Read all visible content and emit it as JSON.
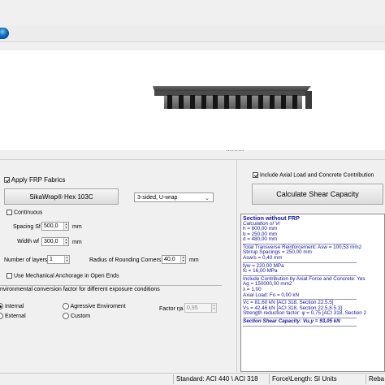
{
  "frp": {
    "apply_label": "Apply FRP Fabrics",
    "product_button": "SikaWrap® Hex 103C",
    "wrap_select": "3-sided, U-wrap",
    "continuous_label": "Continuous",
    "spacing_label": "Spacing Sf",
    "spacing_value": "500,0",
    "spacing_unit": "mm",
    "width_label": "Width wf",
    "width_value": "300,0",
    "width_unit": "mm",
    "layers_label": "Number of layers",
    "layers_value": "1",
    "radius_label": "Radius of Rounding Corners R",
    "radius_value": "40,0",
    "radius_unit": "mm",
    "anchorage_label": "Use Mechanical Anchorage in Open Ends"
  },
  "env": {
    "header": "nvironmental conversion factor for different exposure conditions",
    "options": [
      "Internal",
      "Agressive Enviroment",
      "External",
      "Custom"
    ],
    "factor_label": "Factor ηa",
    "factor_value": "0,95"
  },
  "axial": {
    "include_label": "Include Axial Load and Concrete Contribution",
    "calc_button": "Calculate Shear Capacity"
  },
  "results": [
    {
      "text": "Section without FRP",
      "style": "bold"
    },
    {
      "text": "Calculation of Vr",
      "style": "italic"
    },
    {
      "text": "h = 600,00 mm",
      "style": ""
    },
    {
      "text": "b = 250,00 mm",
      "style": ""
    },
    {
      "text": "d = 480,00 mm",
      "style": ""
    },
    {
      "text": "",
      "style": "sep"
    },
    {
      "text": "Total Transverse Reinforcement: Asw = 100,53 mm2",
      "style": ""
    },
    {
      "text": "Stirrup Spacings = 250,00 mm",
      "style": ""
    },
    {
      "text": "Asw/s = 0,40 mm",
      "style": ""
    },
    {
      "text": "",
      "style": "sep"
    },
    {
      "text": "fyw = 220,00 MPa",
      "style": ""
    },
    {
      "text": "fc = 16,00 MPa",
      "style": ""
    },
    {
      "text": "",
      "style": "sep"
    },
    {
      "text": "Include Contribution by Axial Force and Concrete: Yes",
      "style": ""
    },
    {
      "text": "Ag = 150000,00 mm2",
      "style": ""
    },
    {
      "text": "λ = 1,00",
      "style": ""
    },
    {
      "text": "Axial Load: Fo = 0,00 kN",
      "style": ""
    },
    {
      "text": "",
      "style": "sep"
    },
    {
      "text": "Vc = 81,60 kN          [ACI 318, Section 22.5.5]",
      "style": ""
    },
    {
      "text": "Vs = 42,46 kN          [ACI 318, Section 22.5.8.5.3]",
      "style": ""
    },
    {
      "text": "Strength reduction factor: φ = 0,75      [ACI 318, Section 2",
      "style": ""
    },
    {
      "text": "",
      "style": "sep"
    },
    {
      "text": "Section Shear Capacity: Vu,y = 93,05 kN",
      "style": "boldital"
    },
    {
      "text": "",
      "style": "sep"
    }
  ],
  "status": {
    "standard": "Standard: ACI 440 \\ ACI 318",
    "units": "Force\\Length: SI Units",
    "rebar": "Reba"
  }
}
